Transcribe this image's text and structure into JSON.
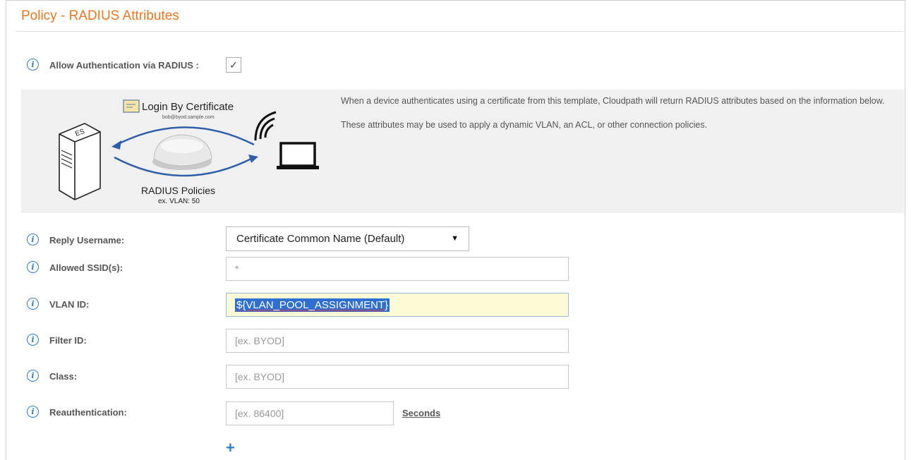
{
  "page": {
    "title": "Policy - RADIUS Attributes"
  },
  "allow_auth": {
    "label": "Allow Authentication via RADIUS :",
    "checked": true,
    "check_glyph": "✓"
  },
  "banner": {
    "paragraph1": "When a device authenticates using a certificate from this template, Cloudpath will return RADIUS attributes based on the information below.",
    "paragraph2": "These attributes may be used to apply a dynamic VLAN, an ACL, or other connection policies.",
    "illustration": {
      "login_title": "Login By Certificate",
      "login_email": "bob@byod.sample.com",
      "policies_title": "RADIUS Policies",
      "policies_example": "ex. VLAN: 50"
    }
  },
  "fields": {
    "reply_username": {
      "label": "Reply Username:",
      "value": "Certificate Common Name (Default)",
      "arrow": "▼"
    },
    "allowed_ssids": {
      "label": "Allowed SSID(s):",
      "value": "*"
    },
    "vlan_id": {
      "label": "VLAN ID:",
      "value": "${VLAN_POOL_ASSIGNMENT}"
    },
    "filter_id": {
      "label": "Filter ID:",
      "placeholder": "[ex. BYOD]"
    },
    "class": {
      "label": "Class:",
      "placeholder": "[ex. BYOD]"
    },
    "reauthentication": {
      "label": "Reauthentication:",
      "placeholder": "[ex. 86400]",
      "unit": "Seconds"
    }
  },
  "add_button": {
    "glyph": "+"
  },
  "colors": {
    "title": "#e87722",
    "info": "#2f7fc8",
    "banner_bg": "#f0f0f0",
    "active_field": "#fffbd7",
    "selection": "#2f6fd0"
  },
  "icons": {
    "info": "info-icon",
    "server": "server-icon",
    "laptop": "laptop-icon",
    "wifi": "wifi-icon",
    "access_point": "access-point-icon",
    "certificate": "certificate-icon"
  }
}
